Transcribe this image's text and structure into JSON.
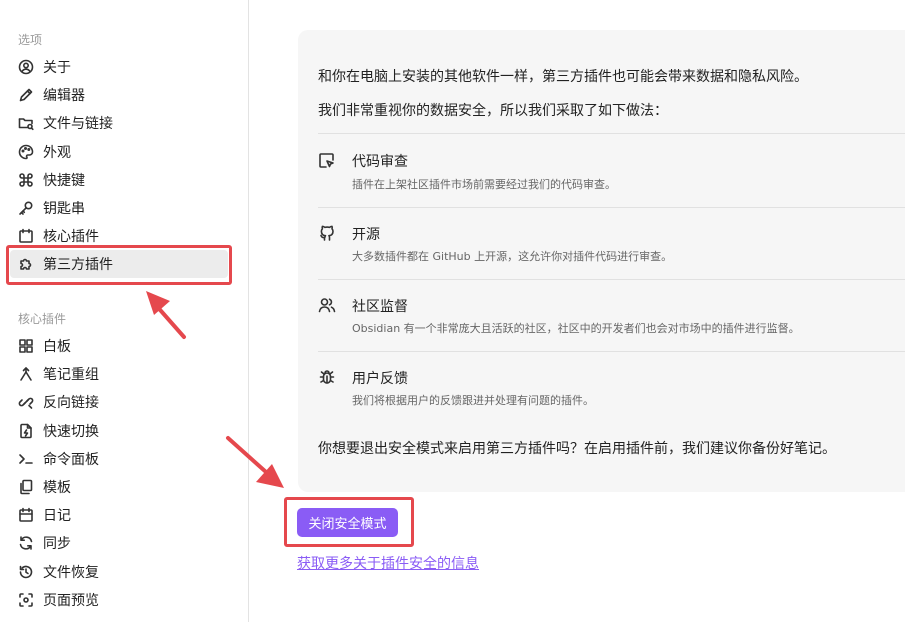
{
  "sidebar": {
    "section_options": "选项",
    "options_items": [
      {
        "label": "关于",
        "icon": "user-circle-icon"
      },
      {
        "label": "编辑器",
        "icon": "pencil-icon"
      },
      {
        "label": "文件与链接",
        "icon": "folder-icon"
      },
      {
        "label": "外观",
        "icon": "palette-icon"
      },
      {
        "label": "快捷键",
        "icon": "command-icon"
      },
      {
        "label": "钥匙串",
        "icon": "key-icon"
      },
      {
        "label": "核心插件",
        "icon": "calendar-plug-icon"
      },
      {
        "label": "第三方插件",
        "icon": "puzzle-icon",
        "active": true
      }
    ],
    "section_core": "核心插件",
    "core_items": [
      {
        "label": "白板",
        "icon": "canvas-grid-icon"
      },
      {
        "label": "笔记重组",
        "icon": "merge-arrow-icon"
      },
      {
        "label": "反向链接",
        "icon": "backlink-icon"
      },
      {
        "label": "快速切换",
        "icon": "quick-switch-icon"
      },
      {
        "label": "命令面板",
        "icon": "terminal-icon"
      },
      {
        "label": "模板",
        "icon": "template-icon"
      },
      {
        "label": "日记",
        "icon": "calendar-icon"
      },
      {
        "label": "同步",
        "icon": "sync-icon"
      },
      {
        "label": "文件恢复",
        "icon": "history-icon"
      },
      {
        "label": "页面预览",
        "icon": "preview-icon"
      }
    ]
  },
  "main": {
    "intro1": "和你在电脑上安装的其他软件一样，第三方插件也可能会带来数据和隐私风险。",
    "intro2": "我们非常重视你的数据安全，所以我们采取了如下做法：",
    "features": [
      {
        "title": "代码审查",
        "desc": "插件在上架社区插件市场前需要经过我们的代码审查。",
        "icon": "code-review-icon"
      },
      {
        "title": "开源",
        "desc": "大多数插件都在 GitHub 上开源，这允许你对插件代码进行审查。",
        "icon": "github-icon"
      },
      {
        "title": "社区监督",
        "desc": "Obsidian 有一个非常庞大且活跃的社区，社区中的开发者们也会对市场中的插件进行监督。",
        "icon": "users-icon"
      },
      {
        "title": "用户反馈",
        "desc": "我们将根据用户的反馈跟进并处理有问题的插件。",
        "icon": "bug-icon"
      }
    ],
    "question": "你想要退出安全模式来启用第三方插件吗？在启用插件前，我们建议你备份好笔记。",
    "button_label": "关闭安全模式",
    "link_label": "获取更多关于插件安全的信息"
  },
  "colors": {
    "accent": "#8a5cf5",
    "highlight": "#e5484d"
  }
}
